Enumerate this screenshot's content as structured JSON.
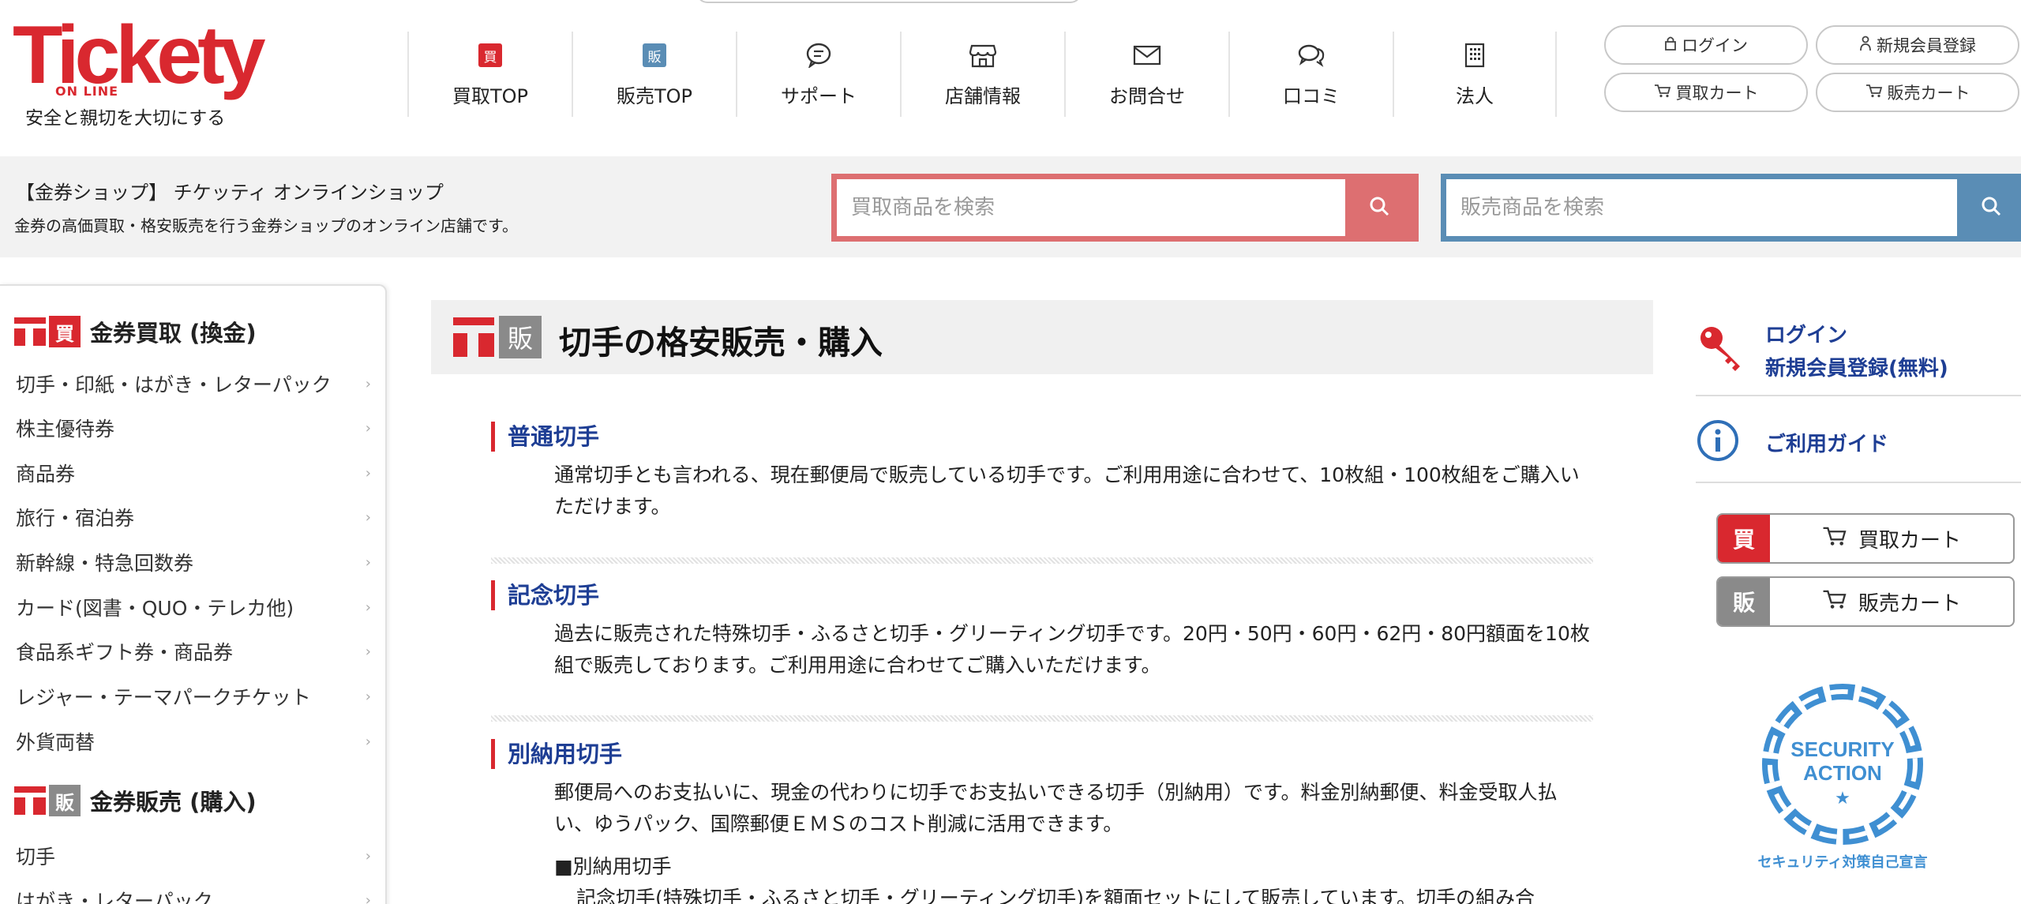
{
  "brand": {
    "logo_text": "Tickety",
    "logo_sub": "ON LINE",
    "tagline": "安全と親切を大切にする",
    "accent_red": "#d9282f",
    "accent_blue": "#5a8db5",
    "link_blue": "#1e3e94"
  },
  "nav": {
    "items": [
      {
        "label": "買取TOP",
        "icon": "buy-badge-icon",
        "badge": "買"
      },
      {
        "label": "販売TOP",
        "icon": "sell-badge-icon",
        "badge": "販"
      },
      {
        "label": "サポート",
        "icon": "chat-bubble-icon"
      },
      {
        "label": "店舗情報",
        "icon": "store-icon"
      },
      {
        "label": "お問合せ",
        "icon": "mail-icon"
      },
      {
        "label": "口コミ",
        "icon": "comments-icon"
      },
      {
        "label": "法人",
        "icon": "building-icon"
      }
    ]
  },
  "account": {
    "login": "ログイン",
    "register": "新規会員登録",
    "buy_cart": "買取カート",
    "sell_cart": "販売カート"
  },
  "band": {
    "title": "【金券ショップ】 チケッティ オンラインショップ",
    "desc": "金券の高価買取・格安販売を行う金券ショップのオンライン店舗です。"
  },
  "search": {
    "buy_placeholder": "買取商品を検索",
    "sell_placeholder": "販売商品を検索"
  },
  "sidebar": {
    "buy_badge": "買",
    "buy_heading": "金券買取 (換金)",
    "buy_items": [
      "切手・印紙・はがき・レターパック",
      "株主優待券",
      "商品券",
      "旅行・宿泊券",
      "新幹線・特急回数券",
      "カード(図書・QUO・テレカ他)",
      "食品系ギフト券・商品券",
      "レジャー・テーマパークチケット",
      "外貨両替"
    ],
    "sell_badge": "販",
    "sell_heading": "金券販売 (購入)",
    "sell_items": [
      "切手",
      "はがき・レターパック"
    ]
  },
  "main": {
    "title_badge": "販",
    "title": "切手の格安販売・購入",
    "sections": [
      {
        "heading": "普通切手",
        "body": "通常切手とも言われる、現在郵便局で販売している切手です。ご利用用途に合わせて、10枚組・100枚組をご購入いただけます。"
      },
      {
        "heading": "記念切手",
        "body": "過去に販売された特殊切手・ふるさと切手・グリーティング切手です。20円・50円・60円・62円・80円額面を10枚組で販売しております。ご利用用途に合わせてご購入いただけます。"
      },
      {
        "heading": "別納用切手",
        "body": "郵便局へのお支払いに、現金の代わりに切手でお支払いできる切手（別納用）です。料金別納郵便、料金受取人払い、ゆうパック、国際郵便ＥＭＳのコスト削減に活用できます。",
        "sub_heading": "■別納用切手",
        "sub_body": "記念切手(特殊切手・ふるさと切手・グリーティング切手)を額面セットにして販売しています。切手の組み合"
      }
    ]
  },
  "right": {
    "login": "ログイン",
    "register": "新規会員登録(無料)",
    "guide": "ご利用ガイド",
    "buy_tag": "買",
    "buy_cart": "買取カート",
    "sell_tag": "販",
    "sell_cart": "販売カート",
    "seal_line1": "SECURITY",
    "seal_line2": "ACTION",
    "seal_caption": "セキュリティ対策自己宣言"
  }
}
